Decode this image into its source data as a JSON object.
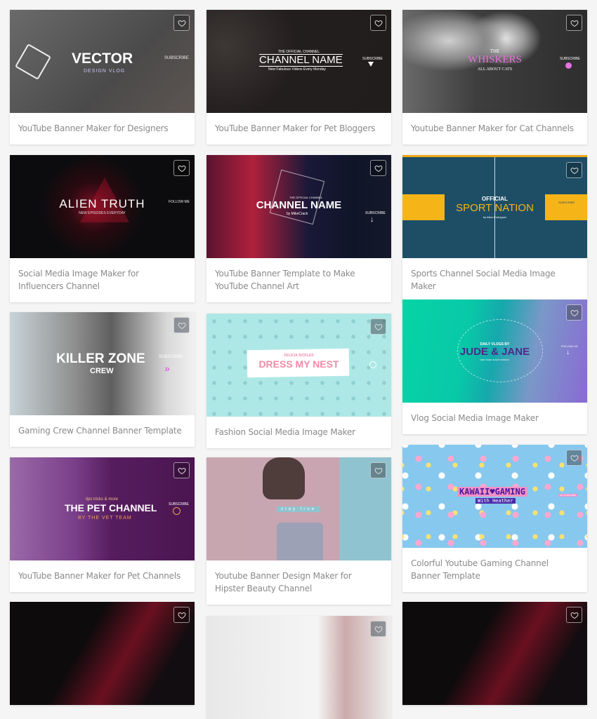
{
  "cards": [
    {
      "title": "YouTube Banner Maker for Designers",
      "banner": {
        "headline": "VECTOR",
        "sub": "DESIGN VLOG",
        "cta": "SUBSCRIBE"
      }
    },
    {
      "title": "YouTube Banner Maker for Pet Bloggers",
      "banner": {
        "kicker": "THE OFFICIAL CHANNEL",
        "headline": "CHANNEL NAME",
        "sub": "New Fabulous Videos Every Monday",
        "cta": "SUBSCRIBE"
      }
    },
    {
      "title": "Youtube Banner Maker for Cat Channels",
      "banner": {
        "kicker": "THE",
        "headline": "WHISKERS",
        "sub": "ALL ABOUT CATS",
        "cta": "SUBSCRIBE"
      }
    },
    {
      "title": "Social Media Image Maker for Influencers Channel",
      "banner": {
        "headline": "ALIEN TRUTH",
        "sub": "NEW EPISODES EVERYDAY",
        "cta": "FOLLOW ME"
      }
    },
    {
      "title": "YouTube Banner Template to Make YouTube Channel Art",
      "banner": {
        "kicker": "THE OFFICIAL CHANNEL",
        "headline": "CHANNEL NAME",
        "sub": "by MikeCrack",
        "cta": "SUBSCRIBE"
      }
    },
    {
      "title": "Sports Channel Social Media Image Maker",
      "banner": {
        "kicker": "OFFICIAL",
        "headline": "SPORT NATION",
        "sub": "by Allan Rodriguez",
        "cta": "SUBSCRIBE"
      }
    },
    {
      "title": "Gaming Crew Channel Banner Template",
      "banner": {
        "headline": "KILLER ZONE",
        "sub": "CREW",
        "cta": "SUBSCRIBE"
      }
    },
    {
      "title": "Fashion Social Media Image Maker",
      "banner": {
        "kicker": "FELICIA SICKLES",
        "headline": "DRESS MY NEST"
      }
    },
    {
      "title": "Vlog Social Media Image Maker",
      "banner": {
        "kicker": "DAILY VLOGS BY",
        "headline": "JUDE & JANE",
        "sub": "NEW VIDEO EVERY MONDAY",
        "cta": "FOLLOW US"
      }
    },
    {
      "title": "YouTube Banner Maker for Pet Channels",
      "banner": {
        "kicker": "tips tricks & more",
        "headline": "THE PET CHANNEL",
        "sub": "BY THE VET TEAM",
        "cta": "SUBSCRIBE"
      }
    },
    {
      "title": "Youtube Banner Design Maker for Hipster Beauty Channel",
      "banner": {
        "headline": "stay true"
      }
    },
    {
      "title": "Colorful Youtube Gaming Channel Banner Template",
      "banner": {
        "headline": "KAWAII♥GAMING",
        "sub": "With Heather",
        "cta": "HIT SUBSCRIBE"
      }
    }
  ],
  "icons": {
    "favorite": "heart-outline-icon"
  }
}
